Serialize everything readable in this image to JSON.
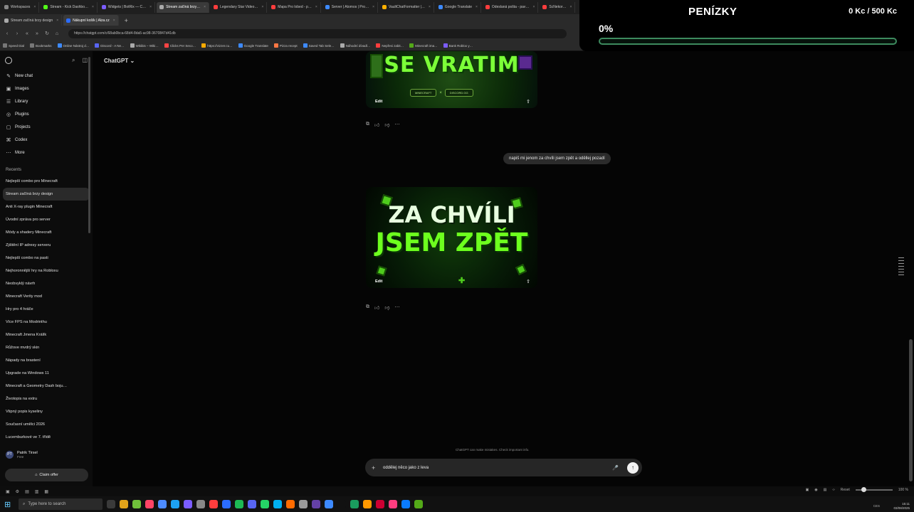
{
  "browser": {
    "tabs_row1": [
      {
        "label": "Workspaces",
        "color": "#888888"
      },
      {
        "label": "Stream - Kick Dashbo…",
        "color": "#53fc18"
      },
      {
        "label": "Widgets | BotRix — C…",
        "color": "#7b5cff"
      },
      {
        "label": "Stream začíná brzy…",
        "color": "#aaaaaa",
        "active": true
      },
      {
        "label": "Legendary Star Video…",
        "color": "#ff3d3d"
      },
      {
        "label": "Mapa Pro lobed - p…",
        "color": "#ff3d3d"
      },
      {
        "label": "Server | Atomos | Pro…",
        "color": "#3d8aff"
      },
      {
        "label": "VaultChatFormatter |…",
        "color": "#ffb000"
      },
      {
        "label": "Google Translate",
        "color": "#3d8aff"
      },
      {
        "label": "Odeslaná pošta - pav…",
        "color": "#ff3d3d"
      },
      {
        "label": "ScNekor…",
        "color": "#ff3d3d"
      }
    ],
    "tabs_row2": [
      {
        "label": "Stream začíná brzy design",
        "color": "#aaaaaa"
      },
      {
        "label": "Nákupní košík | Alza.cz",
        "color": "#2b6cff",
        "active": true
      }
    ],
    "new_tab": "+",
    "url": "https://chatgpt.com/c/68ab0bca-68d4-8da5-ac98-3670847d41db",
    "bookmarks": [
      {
        "label": "Speed Dial",
        "color": "#777777"
      },
      {
        "label": "Bookmarks",
        "color": "#777777"
      },
      {
        "label": "Online Nástroj d…",
        "color": "#3d8aff"
      },
      {
        "label": "Discord - A Ne…",
        "color": "#5865f2"
      },
      {
        "label": "Wikibis – Wiki…",
        "color": "#aaaaaa"
      },
      {
        "label": "Clicks Per Seco…",
        "color": "#ff4444"
      },
      {
        "label": "https://vizzer.cu…",
        "color": "#ffaa00"
      },
      {
        "label": "Google Translate",
        "color": "#3d8aff"
      },
      {
        "label": "Pizza recept",
        "color": "#ff7744"
      },
      {
        "label": "Saved Tab Sele…",
        "color": "#3d8aff"
      },
      {
        "label": "Náhodní dívadl…",
        "color": "#aaaaaa"
      },
      {
        "label": "Nepřesi zabit…",
        "color": "#ff3d3d"
      },
      {
        "label": "Minecraft ima…",
        "color": "#53a818"
      },
      {
        "label": "Bank Roblox y…",
        "color": "#7b5cff"
      }
    ]
  },
  "overlay": {
    "title": "PENÍZKY",
    "amount": "0 Kc / 500 Kc",
    "percent_label": "0%",
    "progress": 0,
    "accent": "#3d8a5e"
  },
  "sidebar": {
    "nav": [
      {
        "label": "New chat",
        "icon": "✎"
      },
      {
        "label": "Images",
        "icon": "▣"
      },
      {
        "label": "Library",
        "icon": "☰"
      },
      {
        "label": "Plugins",
        "icon": "◎"
      },
      {
        "label": "Projects",
        "icon": "▢"
      },
      {
        "label": "Codex",
        "icon": "⌘"
      },
      {
        "label": "More",
        "icon": "⋯"
      }
    ],
    "recents_heading": "Recents",
    "chats": [
      "Nejlepší combo pro Minecraft",
      "Stream začíná brzy design",
      "Anti X-ray plugin Minecraft",
      "Úvodní zpráva pro server",
      "Módy a shadery Minecraft",
      "Zjištění IP adresy serveru",
      "Nejlepší combo na pasti",
      "Nejhoronnější hry na Robloxu",
      "Neobvyklý návrh",
      "Minecraft Verity mod",
      "Hry pro 4 hráče",
      "Více FPS na Modrinthu",
      "Minecraft Jmena Králík",
      "Růžove mvdrý skin",
      "Nápady na brastení",
      "Upgrade na Windows 11",
      "Minecraft a Geometry Dash boju…",
      "Životopis na extru",
      "Vtipný popis kyseliny",
      "Současní umělci 2026",
      "Lucemburkové ve 7. třídě"
    ],
    "active_chat_index": 1,
    "user": {
      "name": "Patrik Tirsel",
      "plan": "Free",
      "initials": "PT"
    },
    "claim_label": "Claim offer"
  },
  "main": {
    "model_label": "ChatGPT",
    "image1": {
      "text": "SE VRATIM",
      "badge_left": "MINECRAFT",
      "badge_right": "DISCORD.GG",
      "edit_label": "Edit"
    },
    "image2": {
      "line1": "ZA CHVÍLI",
      "line2": "JSEM ZPĚT",
      "edit_label": "Edit"
    },
    "user_message": "napiš mi jenom za chvíli jsem zpět a oděllej pozadí",
    "disclaimer": "ChatGPT can make mistakes. Check important info.",
    "composer_value": "oddělej něco jako z leva",
    "send_icon": "↑",
    "mic_icon": "🎤"
  },
  "taskbar": {
    "row1": [
      "▣",
      "⚙",
      "▤",
      "▥",
      "▦"
    ],
    "search_placeholder": "Type here to search",
    "apps": [
      "#3a3a3a",
      "#e0a21a",
      "#6fbf3a",
      "#ff4466",
      "#4d8bff",
      "#1da1f2",
      "#7b5cff",
      "#888888",
      "#ff3d3d",
      "#2b6cff",
      "#1db954",
      "#5865f2",
      "#25d366",
      "#00aff0",
      "#ff6b00",
      "#999999",
      "#6441a5",
      "#3d8aff",
      "#111111",
      "#1a9c5e",
      "#ff9900",
      "#cc0033",
      "#ff3d7f",
      "#0a7bff",
      "#53a818"
    ],
    "zoom_label": "Reset",
    "zoom_value": "100 %",
    "lang": "CES",
    "time": "15:11",
    "date": "03/08/2025"
  }
}
